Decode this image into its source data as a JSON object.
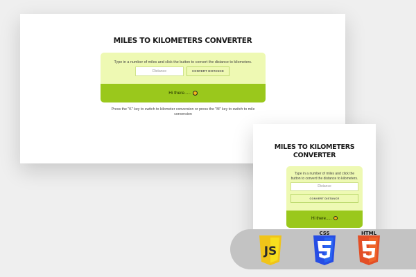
{
  "app": {
    "title": "MILES TO KILOMETERS CONVERTER",
    "instruction": "Type in a number of miles and click the button to convert the distance to kilometers.",
    "distance_placeholder": "Distance",
    "convert_button_label": "CONVERT DISTANCE",
    "result_text": "Hi there.....",
    "result_icon": "emoji-icon",
    "hint": "Press the \"K\" key to switch to kilometer conversion or press the \"M\" key to switch to mile conversion",
    "small_hint_fragment": "Press the \"K\" key to switch to kilometer conversion or press the \"M\" key to switch to mile conversion"
  },
  "badges": {
    "css_label": "CSS",
    "html_label": "HTML",
    "js_icon": "js-logo-icon",
    "css_icon": "css3-logo-icon",
    "html_icon": "html5-logo-icon"
  },
  "colors": {
    "page_bg": "#efefef",
    "card_bg": "#eef9b3",
    "result_bar": "#9ac81c",
    "js_yellow": "#f7df1e",
    "css_blue": "#264de4",
    "html_orange": "#e34f26",
    "pill": "#c3c3c3"
  }
}
